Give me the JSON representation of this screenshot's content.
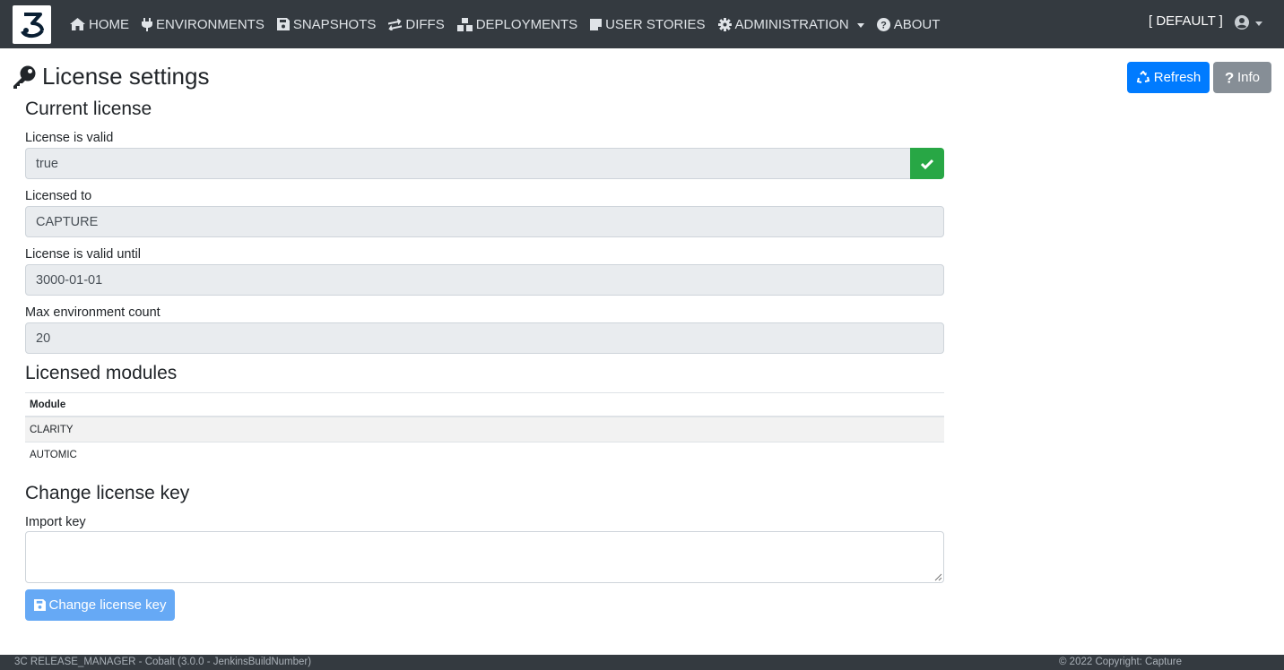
{
  "nav": {
    "items": [
      {
        "label": "HOME",
        "icon": "home-icon"
      },
      {
        "label": "ENVIRONMENTS",
        "icon": "plug-icon"
      },
      {
        "label": "SNAPSHOTS",
        "icon": "save-icon"
      },
      {
        "label": "DIFFS",
        "icon": "exchange-icon"
      },
      {
        "label": "DEPLOYMENTS",
        "icon": "cubes-icon"
      },
      {
        "label": "USER STORIES",
        "icon": "sticky-note-icon"
      },
      {
        "label": "ADMINISTRATION",
        "icon": "cog-icon"
      },
      {
        "label": "ABOUT",
        "icon": "question-circle-icon"
      }
    ],
    "tenant": "[ DEFAULT ]",
    "user_icon": "user-circle-icon"
  },
  "page": {
    "title": "License settings",
    "title_icon": "key-icon",
    "refresh_label": "Refresh",
    "info_label": "Info"
  },
  "current_license": {
    "heading": "Current license",
    "valid_label": "License is valid",
    "valid_value": "true",
    "licensed_to_label": "Licensed to",
    "licensed_to_value": "CAPTURE",
    "valid_until_label": "License is valid until",
    "valid_until_value": "3000-01-01",
    "max_env_label": "Max environment count",
    "max_env_value": "20"
  },
  "modules": {
    "heading": "Licensed modules",
    "column": "Module",
    "rows": [
      "CLARITY",
      "AUTOMIC"
    ]
  },
  "change_key": {
    "heading": "Change license key",
    "import_label": "Import key",
    "import_value": "",
    "button_label": "Change license key"
  },
  "footer": {
    "left": "3C RELEASE_MANAGER - Cobalt (3.0.0 - JenkinsBuildNumber)",
    "right": "© 2022 Copyright: Capture"
  },
  "colors": {
    "navbar": "#343a40",
    "primary": "#007bff",
    "secondary": "#868e96",
    "success": "#28a745"
  }
}
